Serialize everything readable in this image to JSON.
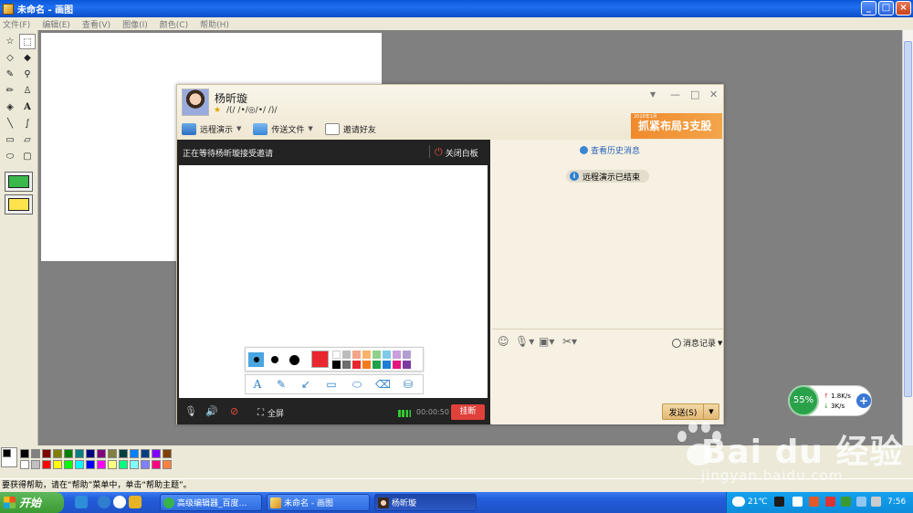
{
  "paint": {
    "title": "未命名 - 画图",
    "menu": [
      "文件(F)",
      "编辑(E)",
      "查看(V)",
      "图像(I)",
      "颜色(C)",
      "帮助(H)"
    ],
    "status_text": "要获得帮助，请在“帮助”菜单中，单击“帮助主题”。",
    "palette_colors": [
      "#000000",
      "#808080",
      "#800000",
      "#808000",
      "#008000",
      "#008080",
      "#000080",
      "#800080",
      "#808040",
      "#004040",
      "#0080ff",
      "#004080",
      "#8000ff",
      "#804000",
      "#ffffff",
      "#c0c0c0",
      "#ff0000",
      "#ffff00",
      "#00ff00",
      "#00ffff",
      "#0000ff",
      "#ff00ff",
      "#ffff80",
      "#00ff80",
      "#80ffff",
      "#8080ff",
      "#ff0080",
      "#ff8040"
    ]
  },
  "qq": {
    "contact_name": "杨昕璇",
    "signature": "/(/ /•/◎/•/ /)/",
    "toolbar": {
      "remote_demo": "远程演示",
      "send_file": "传送文件",
      "invite": "邀请好友"
    },
    "ad_tag": "2018年1月",
    "ad_text": "抓紧布局3支股",
    "whiteboard": {
      "waiting_text": "正在等待杨昕璇接受邀请",
      "close_label": "关闭白板",
      "fullscreen_label": "全屏",
      "timer": "00:00:50",
      "hangup_label": "挂断",
      "current_color": "#e8262f",
      "swatches": [
        "#ffffff",
        "#bcbcbc",
        "#f4a58a",
        "#f7b36a",
        "#8fd18b",
        "#7ecbe9",
        "#c9a0dc",
        "#b39ed0",
        "#000000",
        "#6d6d6d",
        "#e8262f",
        "#f07c1f",
        "#1fa34a",
        "#1e7fd4",
        "#e4157f",
        "#7a3aa0"
      ]
    },
    "chat": {
      "history_link": "查看历史消息",
      "notice": "远程演示已结束",
      "msg_record": "消息记录",
      "send_label": "发送(S)"
    }
  },
  "net_widget": {
    "percent": "55%",
    "up_speed": "1.8K/s",
    "down_speed": "3K/s"
  },
  "taskbar": {
    "start_label": "开始",
    "tasks": [
      "高级编辑器_百度…",
      "未命名 - 画图",
      "杨昕璇"
    ],
    "weather": "21℃",
    "clock": "7:56"
  },
  "watermark": {
    "logo": "Bai du 经验",
    "url": "jingyan.baidu.com"
  }
}
